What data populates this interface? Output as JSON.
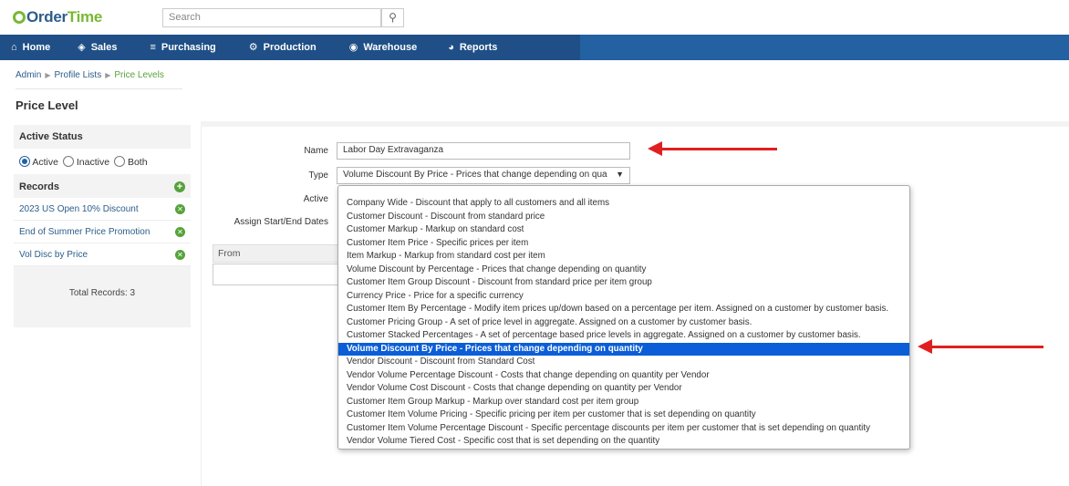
{
  "app": {
    "logo_text_1": "Order",
    "logo_text_2": "Time"
  },
  "search": {
    "placeholder": "Search",
    "icon": "search-icon"
  },
  "nav": {
    "items": [
      {
        "label": "Home",
        "icon": "home-icon",
        "glyph": "⌂"
      },
      {
        "label": "Sales",
        "icon": "tag-icon",
        "glyph": "◈"
      },
      {
        "label": "Purchasing",
        "icon": "cart-icon",
        "glyph": "≡"
      },
      {
        "label": "Production",
        "icon": "gears-icon",
        "glyph": "⚙"
      },
      {
        "label": "Warehouse",
        "icon": "box-icon",
        "glyph": "◉"
      },
      {
        "label": "Reports",
        "icon": "pie-chart-icon",
        "glyph": "◕"
      }
    ]
  },
  "breadcrumb": {
    "items": [
      "Admin",
      "Profile Lists",
      "Price Levels"
    ]
  },
  "page": {
    "title": "Price Level"
  },
  "sidebar": {
    "status_heading": "Active Status",
    "radios": [
      {
        "label": "Active",
        "checked": true
      },
      {
        "label": "Inactive",
        "checked": false
      },
      {
        "label": "Both",
        "checked": false
      }
    ],
    "records_heading": "Records",
    "records": [
      {
        "label": "2023 US Open 10% Discount"
      },
      {
        "label": "End of Summer Price Promotion"
      },
      {
        "label": "Vol Disc by Price"
      }
    ],
    "total": "Total Records: 3"
  },
  "form": {
    "name_label": "Name",
    "name_value": "Labor Day Extravaganza",
    "type_label": "Type",
    "type_value": "Volume Discount By Price - Prices that change depending on qua",
    "active_label": "Active",
    "dates_label": "Assign Start/End Dates",
    "grid_from": "From"
  },
  "dropdown": {
    "options": [
      "Company Wide - Discount that apply to all customers and all items",
      "Customer Discount - Discount from standard price",
      "Customer Markup - Markup on standard cost",
      "Customer Item Price - Specific prices per item",
      "Item Markup - Markup from standard cost per item",
      "Volume Discount by Percentage - Prices that change depending on quantity",
      "Customer Item Group Discount - Discount from standard price per item group",
      "Currency Price - Price for a specific currency",
      "Customer Item By Percentage - Modify item prices up/down based on a percentage per item. Assigned on a customer by customer basis.",
      "Customer Pricing Group - A set of price level in aggregate. Assigned on a customer by customer basis.",
      "Customer Stacked Percentages - A set of percentage based price levels in aggregate. Assigned on a customer by customer basis.",
      "Volume Discount By Price - Prices that change depending on quantity",
      "Vendor Discount - Discount from Standard Cost",
      "Vendor Volume Percentage Discount - Costs that change depending on quantity per Vendor",
      "Vendor Volume Cost Discount - Costs that change depending on quantity per Vendor",
      "Customer Item Group Markup - Markup over standard cost per item group",
      "Customer Item Volume Pricing - Specific pricing per item per customer that is set depending on quantity",
      "Customer Item Volume Percentage Discount - Specific percentage discounts per item per customer that is set depending on quantity",
      "Vendor Volume Tiered Cost - Specific cost that is set depending on the quantity"
    ],
    "selected_index": 11
  },
  "colors": {
    "nav": "#1f4f86",
    "accent_green": "#57a23b",
    "selected": "#0b5ed7",
    "annotation_arrow": "#e02020"
  }
}
